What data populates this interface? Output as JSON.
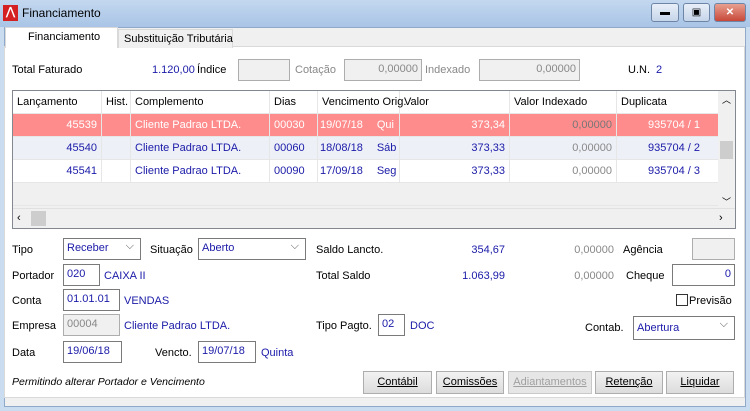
{
  "window": {
    "title": "Financiamento"
  },
  "tabs": [
    "Financiamento",
    "Substituição Tributária"
  ],
  "header": {
    "total_faturado_label": "Total Faturado",
    "total_faturado": "1.120,00",
    "indice_label": "Índice",
    "indice": "",
    "cotacao_label": "Cotação",
    "cotacao": "0,00000",
    "indexado_label": "Indexado",
    "indexado": "0,00000",
    "un_label": "U.N.",
    "un": "2"
  },
  "grid": {
    "columns": [
      "Lançamento",
      "Hist.",
      "Complemento",
      "Dias",
      "Vencimento Orig.",
      "Valor",
      "Valor Indexado",
      "Duplicata"
    ],
    "rows": [
      {
        "lanc": "45539",
        "hist": "",
        "comp": "Cliente Padrao LTDA.",
        "dias": "00030",
        "venc": "19/07/18",
        "dow": "Qui",
        "valor": "373,34",
        "vidx": "0,00000",
        "dup": "935704 / 1"
      },
      {
        "lanc": "45540",
        "hist": "",
        "comp": "Cliente Padrao LTDA.",
        "dias": "00060",
        "venc": "18/08/18",
        "dow": "Sáb",
        "valor": "373,33",
        "vidx": "0,00000",
        "dup": "935704 / 2"
      },
      {
        "lanc": "45541",
        "hist": "",
        "comp": "Cliente Padrao LTDA.",
        "dias": "00090",
        "venc": "17/09/18",
        "dow": "Seg",
        "valor": "373,33",
        "vidx": "0,00000",
        "dup": "935704 / 3"
      }
    ]
  },
  "form": {
    "tipo_label": "Tipo",
    "tipo": "Receber",
    "situacao_label": "Situação",
    "situacao": "Aberto",
    "saldo_lancto_label": "Saldo Lancto.",
    "saldo_lancto": "354,67",
    "saldo_lancto_idx": "0,00000",
    "agencia_label": "Agência",
    "agencia": "",
    "portador_label": "Portador",
    "portador": "020",
    "portador_nome": "CAIXA II",
    "total_saldo_label": "Total Saldo",
    "total_saldo": "1.063,99",
    "total_saldo_idx": "0,00000",
    "cheque_label": "Cheque",
    "cheque": "0",
    "conta_label": "Conta",
    "conta": "01.01.01",
    "conta_nome": "VENDAS",
    "previsao_label": "Previsão",
    "empresa_label": "Empresa",
    "empresa": "00004",
    "empresa_nome": "Cliente Padrao LTDA.",
    "tipo_pagto_label": "Tipo Pagto.",
    "tipo_pagto": "02",
    "tipo_pagto_nome": "DOC",
    "contab_label": "Contab.",
    "contab": "Abertura",
    "data_label": "Data",
    "data": "19/06/18",
    "vencto_label": "Vencto.",
    "vencto": "19/07/18",
    "vencto_dia": "Quinta"
  },
  "status": "Permitindo alterar Portador e Vencimento",
  "buttons": [
    "Contábil",
    "Comissões",
    "Adiantamentos",
    "Retenção",
    "Liquidar"
  ]
}
